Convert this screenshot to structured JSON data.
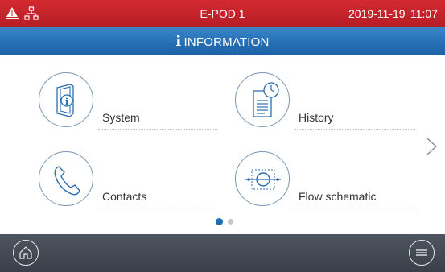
{
  "statusbar": {
    "device": "E-POD 1",
    "date": "2019-11-19",
    "time": "11:07",
    "alarm_icon": "alarm-bell-icon",
    "network_icon": "network-icon"
  },
  "titlebar": {
    "icon": "info-icon",
    "info_glyph": "i",
    "title": "INFORMATION"
  },
  "tiles": [
    {
      "label": "System",
      "icon": "device-info-icon"
    },
    {
      "label": "History",
      "icon": "history-document-icon"
    },
    {
      "label": "Contacts",
      "icon": "phone-icon"
    },
    {
      "label": "Flow schematic",
      "icon": "flow-schematic-icon"
    }
  ],
  "pager": {
    "current_page": 1,
    "total_pages": 2
  },
  "footer": {
    "home_icon": "home-icon",
    "menu_icon": "menu-icon"
  },
  "colors": {
    "status_red": "#c8232c",
    "title_blue": "#2670b6",
    "footer_gray": "#444b54",
    "dot_active": "#1f6fb5",
    "dot_inactive": "#c8c8c8"
  }
}
